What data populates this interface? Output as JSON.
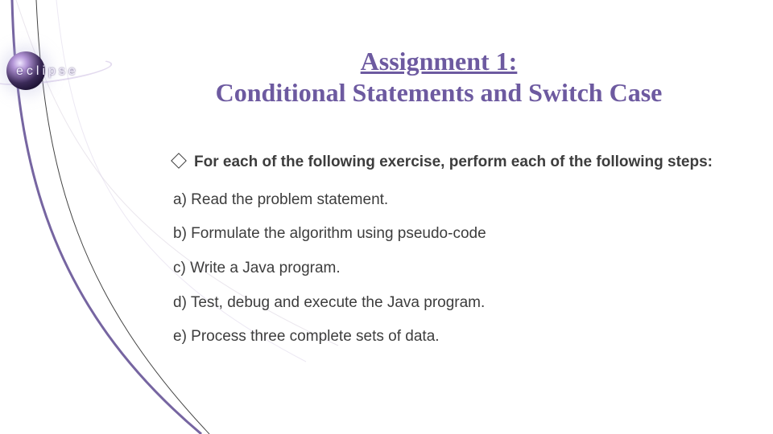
{
  "logo": {
    "wordmark": "eclipse"
  },
  "title": {
    "line1": "Assignment 1:",
    "line2": "Conditional Statements and Switch Case"
  },
  "intro": "For each of the following exercise, perform each of the following steps:",
  "steps": [
    "a) Read the problem statement.",
    "b) Formulate the algorithm using pseudo-code",
    "c) Write a Java program.",
    "d) Test, debug and execute the Java program.",
    "e) Process three complete sets of data."
  ]
}
